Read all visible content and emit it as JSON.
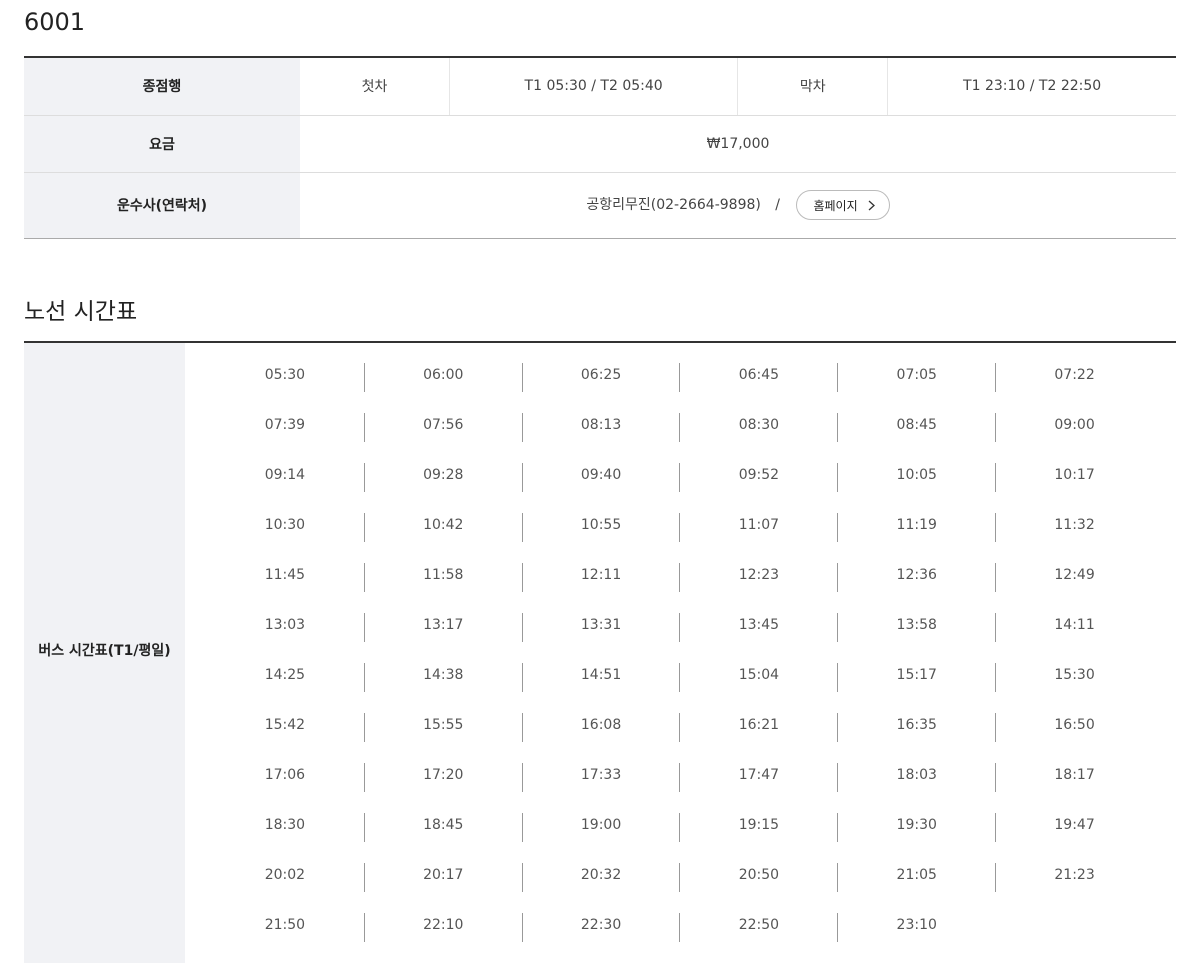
{
  "route": {
    "number": "6001"
  },
  "info": {
    "terminal_label": "종점행",
    "first_label": "첫차",
    "first_time": "T1 05:30 / T2 05:40",
    "last_label": "막차",
    "last_time": "T1 23:10 / T2 22:50",
    "fare_label": "요금",
    "fare_value": "₩17,000",
    "operator_label": "운수사(연락처)",
    "operator_value": "공항리무진(02-2664-9898)",
    "operator_sep": "/",
    "homepage_label": "홈페이지"
  },
  "timetable": {
    "section_title": "노선 시간표",
    "header": "버스 시간표(T1/평일)",
    "rows": [
      [
        "05:30",
        "06:00",
        "06:25",
        "06:45",
        "07:05",
        "07:22"
      ],
      [
        "07:39",
        "07:56",
        "08:13",
        "08:30",
        "08:45",
        "09:00"
      ],
      [
        "09:14",
        "09:28",
        "09:40",
        "09:52",
        "10:05",
        "10:17"
      ],
      [
        "10:30",
        "10:42",
        "10:55",
        "11:07",
        "11:19",
        "11:32"
      ],
      [
        "11:45",
        "11:58",
        "12:11",
        "12:23",
        "12:36",
        "12:49"
      ],
      [
        "13:03",
        "13:17",
        "13:31",
        "13:45",
        "13:58",
        "14:11"
      ],
      [
        "14:25",
        "14:38",
        "14:51",
        "15:04",
        "15:17",
        "15:30"
      ],
      [
        "15:42",
        "15:55",
        "16:08",
        "16:21",
        "16:35",
        "16:50"
      ],
      [
        "17:06",
        "17:20",
        "17:33",
        "17:47",
        "18:03",
        "18:17"
      ],
      [
        "18:30",
        "18:45",
        "19:00",
        "19:15",
        "19:30",
        "19:47"
      ],
      [
        "20:02",
        "20:17",
        "20:32",
        "20:50",
        "21:05",
        "21:23"
      ],
      [
        "21:50",
        "22:10",
        "22:30",
        "22:50",
        "23:10"
      ]
    ]
  },
  "icons": {
    "homepage_arrow": "chevron-right-icon"
  },
  "colors": {
    "header_bg": "#f1f2f5",
    "border_dark": "#333333"
  }
}
